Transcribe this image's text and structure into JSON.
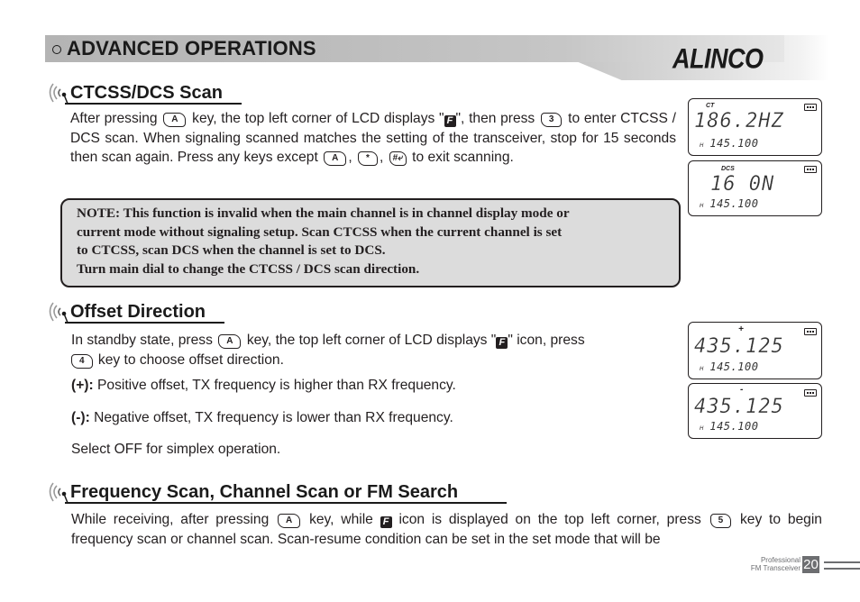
{
  "header": {
    "title": "ADVANCED OPERATIONS",
    "brand": "ALINCO"
  },
  "sections": [
    {
      "title": "CTCSS/DCS Scan",
      "paragraph": {
        "p1": "After pressing",
        "key1": "A",
        "p2": "key, the top left corner of LCD displays \"",
        "p3": "\", then press",
        "key2": "3",
        "p4": "to enter CTCSS / DCS scan. When signaling scanned matches the setting of the transceiver, stop for 15 seconds then scan again. Press any keys except",
        "key3": "A",
        "sep1": ",",
        "key4": "*",
        "sep2": ",",
        "key5": "#⤶",
        "p5": "to exit scanning."
      },
      "note": [
        "NOTE:  This function is invalid when the main channel is in channel display mode or",
        "current mode without signaling setup. Scan CTCSS when the current channel is set",
        "to CTCSS, scan DCS when the channel is set to DCS.",
        "Turn main dial to change the CTCSS / DCS scan direction."
      ]
    },
    {
      "title": "Offset Direction",
      "paragraph": {
        "p1": "In standby state, press",
        "key1": "A",
        "p2": "key, the top left corner of LCD displays \"",
        "p3": "\" icon, press",
        "key2": "4",
        "p4": "key to choose offset direction."
      },
      "items": [
        {
          "label": "(+):",
          "text": " Positive offset, TX frequency is higher than RX frequency."
        },
        {
          "label": "(-):",
          "text": " Negative offset, TX frequency is lower than RX frequency."
        }
      ],
      "footer_text": "Select OFF for simplex operation."
    },
    {
      "title": "Frequency Scan, Channel Scan or FM Search",
      "paragraph": {
        "p1": "While receiving, after pressing",
        "key1": "A",
        "p2": "key, while",
        "p3": "icon is displayed on the top left corner, press",
        "key2": "5",
        "p4": "key to begin frequency scan or channel scan. Scan-resume condition can be set in the set mode that will be"
      }
    }
  ],
  "f_icon": "F",
  "lcds": [
    {
      "tag": "CT",
      "main": "186.2HZ",
      "sub_label": "H",
      "sub": "145.100"
    },
    {
      "tag": "DCS",
      "main": "16 0N",
      "sub_label": "H",
      "sub": "145.100"
    },
    {
      "tag": "+",
      "main": "435.125",
      "sub_label": "H",
      "sub": "145.100"
    },
    {
      "tag": "-",
      "main": "435.125",
      "sub_label": "H",
      "sub": "145.100"
    }
  ],
  "footer": {
    "line1": "Professional",
    "line2": "FM Transceiver",
    "page": "20"
  }
}
